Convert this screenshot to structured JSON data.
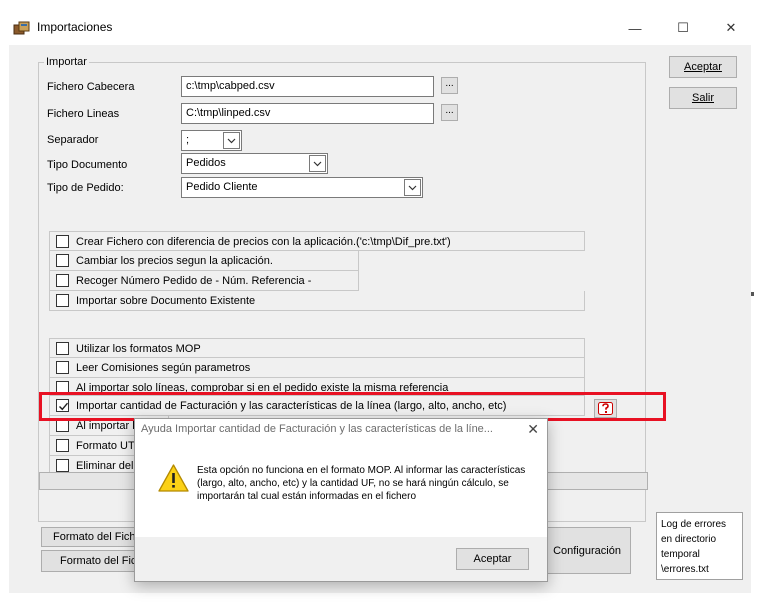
{
  "window": {
    "title": "Importaciones",
    "minimize_glyph": "—",
    "maximize_glyph": "☐",
    "close_glyph": "✕"
  },
  "import_group": {
    "title": "Importar",
    "header_file_label": "Fichero Cabecera",
    "header_file_value": "c:\\tmp\\cabped.csv",
    "lines_file_label": "Fichero Lineas",
    "lines_file_value": "C:\\tmp\\linped.csv",
    "browse_label": "...",
    "separator_label": "Separador",
    "separator_value": ";",
    "doc_type_label": "Tipo Documento",
    "doc_type_value": "Pedidos",
    "order_type_label": "Tipo de Pedido:",
    "order_type_value": "Pedido Cliente"
  },
  "options_1": [
    "Crear Fichero con diferencia de precios con la aplicación.('c:\\tmp\\Dif_pre.txt')",
    "Cambiar los precios segun la aplicación.",
    "Recoger Número Pedido de - Núm. Referencia -",
    "Importar sobre Documento Existente"
  ],
  "options_2": [
    "Utilizar los formatos MOP",
    "Leer Comisiones según parametros",
    "Al importar solo líneas, comprobar si en el pedido existe la misma referencia",
    "Importar cantidad de Facturación y las características de la línea (largo, alto, ancho, etc)",
    "Al importar lír",
    "Formato UTF",
    "Eliminar del C"
  ],
  "help_icon": "help-icon",
  "buttons": {
    "accept": "Aceptar",
    "exit": "Salir",
    "header_format": "Formato del Fiche",
    "lines_format": "Formato del Fich",
    "config": "Configuración"
  },
  "log_note": [
    "Log de errores",
    "en directorio",
    "temporal",
    "\\errores.txt"
  ],
  "dialog": {
    "title": "Ayuda Importar cantidad de Facturación y las características de la líne...",
    "close_glyph": "✕",
    "message": "Esta opción no funciona en el formato MOP. Al informar las características (largo, alto, ancho, etc) y la cantidad UF, no se hará ningún cálculo,  se importarán tal cual están informadas en el fichero",
    "ok": "Aceptar",
    "icon": "warning-icon"
  },
  "colors": {
    "highlight": "#e81123",
    "warning": "#fcd116",
    "background": "#f0f0f0"
  }
}
